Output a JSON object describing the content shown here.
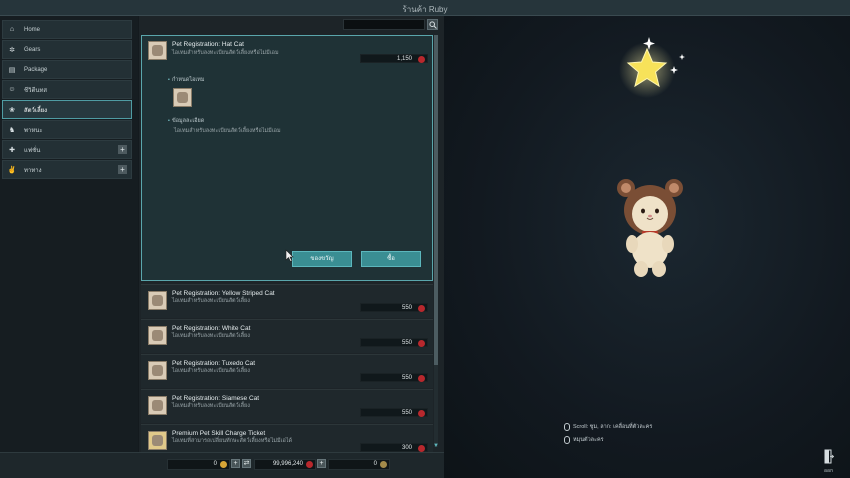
{
  "window": {
    "title": "ร้านค้า Ruby"
  },
  "sidebar": {
    "items": [
      {
        "label": "Home",
        "icon": "home-icon"
      },
      {
        "label": "Gears",
        "icon": "gear-icon"
      },
      {
        "label": "Package",
        "icon": "package-icon"
      },
      {
        "label": "ชีวิตีนทส",
        "icon": "person-icon"
      },
      {
        "label": "สัตว์เลี้ยง",
        "icon": "paw-icon",
        "active": true
      },
      {
        "label": "พาหนะ",
        "icon": "mount-icon"
      },
      {
        "label": "แฟชั่น",
        "icon": "shirt-icon",
        "expandable": true
      },
      {
        "label": "ทาทาง",
        "icon": "emote-icon",
        "expandable": true
      }
    ]
  },
  "selected": {
    "name": "Pet Registration: Hat Cat",
    "desc": "ไอเทมสำหรับลงทะเบียนสัตว์เลี้ยงหรือไม่มีเอม",
    "price": "1,150",
    "section1": "กำหนดไอเทม",
    "section2": "ข้อมูลละเอียด",
    "detail": "ไอเทมสำหรับลงทะเบียนสัตว์เลี้ยงหรือไม่มีเอม",
    "gift_label": "ของขวัญ",
    "buy_label": "ซื้อ"
  },
  "items": [
    {
      "name": "Pet Registration: Yellow Striped Cat",
      "desc": "ไอเทมสำหรับลงทะเบียนสัตว์เลี้ยง",
      "price": "550"
    },
    {
      "name": "Pet Registration: White Cat",
      "desc": "ไอเทมสำหรับลงทะเบียนสัตว์เลี้ยง",
      "price": "550"
    },
    {
      "name": "Pet Registration: Tuxedo Cat",
      "desc": "ไอเทมสำหรับลงทะเบียนสัตว์เลี้ยง",
      "price": "550"
    },
    {
      "name": "Pet Registration: Siamese Cat",
      "desc": "ไอเทมสำหรับลงทะเบียนสัตว์เลี้ยง",
      "price": "550"
    },
    {
      "name": "Premium Pet Skill Charge Ticket",
      "desc": "ไอเทมที่สามารถเปลี่ยนทักษะสัตว์เลี้ยงหรือไม่มีเอได้",
      "price": "300"
    }
  ],
  "currency": {
    "coin": "0",
    "ruby": "99,996,240",
    "gear": "0"
  },
  "hints": {
    "scroll": "Scroll: ซูม, ลาก: เคลื่อนที่ตัวละคร",
    "rotate": "หมุนตัวละคร"
  },
  "exit_label": "ออก",
  "colors": {
    "accent": "#5aa6ac",
    "button": "#3a8e93",
    "ruby": "#b8282d",
    "coin": "#d7a536"
  }
}
